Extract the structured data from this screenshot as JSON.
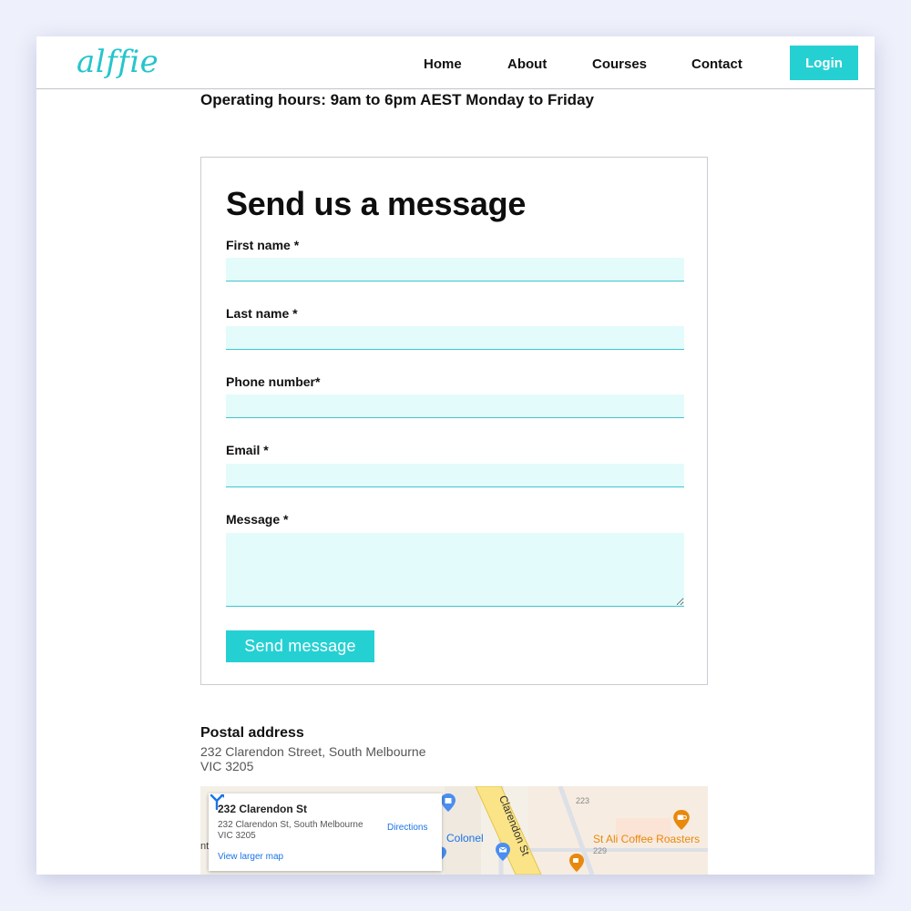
{
  "header": {
    "logo": "alffie",
    "nav": [
      "Home",
      "About",
      "Courses",
      "Contact"
    ],
    "login_label": "Login"
  },
  "hours": "Operating hours: 9am to 6pm AEST Monday to Friday",
  "form": {
    "title": "Send us a message",
    "fields": [
      {
        "label": "First name *",
        "value": ""
      },
      {
        "label": "Last name *",
        "value": ""
      },
      {
        "label": "Phone number*",
        "value": ""
      },
      {
        "label": "Email *",
        "value": ""
      }
    ],
    "message_label": "Message *",
    "message_value": "",
    "submit_label": "Send message"
  },
  "postal": {
    "heading": "Postal address",
    "line1": "232 Clarendon Street, South Melbourne",
    "line2": "VIC 3205"
  },
  "map": {
    "card_title": "232 Clarendon St",
    "card_address_line1": "232 Clarendon St, South Melbourne",
    "card_address_line2": "VIC 3205",
    "directions_label": "Directions",
    "view_larger_label": "View larger map",
    "street_label": "Clarendon St",
    "place_colonel": "Colonel",
    "place_coffee": "St Ali Coffee Roasters",
    "number_223": "223",
    "number_229": "229",
    "partial_left": "nt"
  },
  "colors": {
    "accent": "#25d0d3",
    "logo": "#25c5cc",
    "input_bg": "#e3fbfb",
    "link": "#1a73e8",
    "coffee": "#e8890c"
  }
}
